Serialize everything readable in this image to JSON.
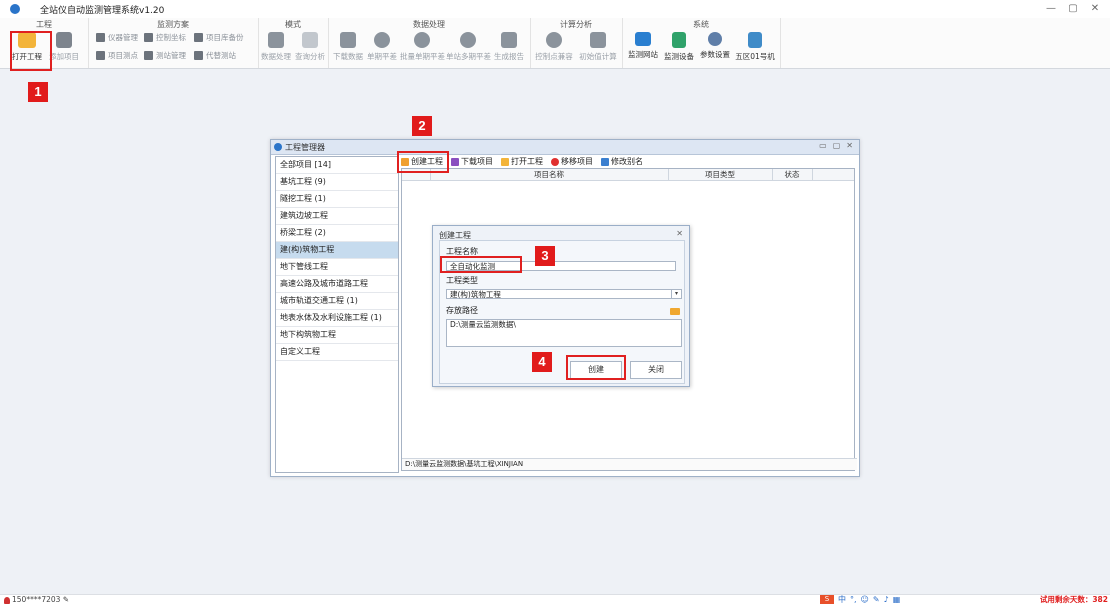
{
  "app": {
    "title": "全站仪自动监测管理系统v1.20"
  },
  "ribbon": {
    "groups": [
      "工程",
      "监测方案",
      "模式",
      "数据处理",
      "计算分析",
      "系统"
    ],
    "project": {
      "open": "打开工程",
      "add": "添加项目"
    },
    "plan": {
      "instrument": "仪器管理",
      "control": "控制坐标",
      "backup": "项目库备份",
      "points": "项目测点",
      "station": "测站管理",
      "alt_station": "代替测站"
    },
    "mode": {
      "process": "数据处理",
      "query": "查询分析"
    },
    "data": {
      "download": "下载数据",
      "single": "单期平差",
      "batch": "批量单期平差",
      "multi": "单站多期平差",
      "report": "生成报告"
    },
    "calc": {
      "check": "控制点兼容",
      "init": "初始值计算"
    },
    "system": {
      "site": "监测网站",
      "device": "监测设备",
      "params": "参数设置",
      "wuqi": "五区01号机"
    }
  },
  "project_manager": {
    "title": "工程管理器",
    "categories": [
      "全部项目 [14]",
      "基坑工程 (9)",
      "隧挖工程 (1)",
      "建筑边坡工程",
      "桥梁工程 (2)",
      "建(构)筑物工程",
      "地下管线工程",
      "高速公路及城市道路工程",
      "城市轨道交通工程 (1)",
      "地表水体及水利设施工程 (1)",
      "地下构筑物工程",
      "自定义工程"
    ],
    "toolbar": {
      "create": "创建工程",
      "download": "下载项目",
      "open": "打开工程",
      "move": "移移项目",
      "rename": "修改别名"
    },
    "columns": [
      "项目名称",
      "项目类型",
      "状态"
    ],
    "status_path": "D:\\测量云监测数据\\基坑工程\\XINJIAN"
  },
  "create_dialog": {
    "title": "创建工程",
    "name_label": "工程名称",
    "name_value": "全自动化监测",
    "type_label": "工程类型",
    "type_value": "建(构)筑物工程",
    "path_label": "存放路径",
    "path_value": "D:\\测量云监测数据\\",
    "create_btn": "创建",
    "close_btn": "关闭"
  },
  "badges": [
    "1",
    "2",
    "3",
    "4"
  ],
  "statusbar": {
    "user": "150****7203",
    "trial": "试用剩余天数：382"
  },
  "colors": {
    "highlight": "#e02020",
    "selection": "#c6dbee",
    "accent": "#2a74c9"
  }
}
